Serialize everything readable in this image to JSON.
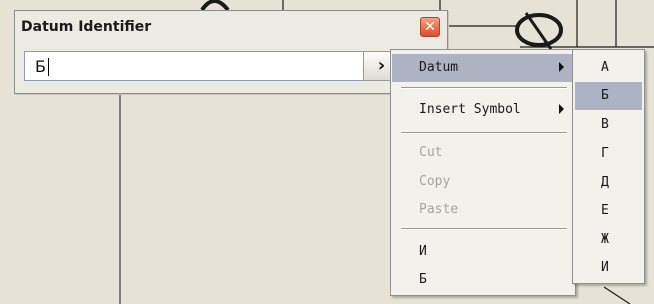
{
  "dialog": {
    "title": "Datum Identifier",
    "close_glyph": "✕",
    "field_value": "Б",
    "arrow_glyph": "›"
  },
  "menu": {
    "items": [
      {
        "label": "Datum",
        "state": "highlighted",
        "submenu": true
      },
      {
        "label": "Insert Symbol",
        "state": "enabled",
        "submenu": true
      },
      {
        "label": "Cut",
        "state": "disabled"
      },
      {
        "label": "Copy",
        "state": "disabled"
      },
      {
        "label": "Paste",
        "state": "disabled"
      },
      {
        "label": "И",
        "state": "enabled"
      },
      {
        "label": "Б",
        "state": "enabled"
      }
    ]
  },
  "submenu": {
    "items": [
      {
        "label": "А",
        "state": "enabled"
      },
      {
        "label": "Б",
        "state": "highlighted"
      },
      {
        "label": "В",
        "state": "enabled"
      },
      {
        "label": "Г",
        "state": "enabled"
      },
      {
        "label": "Д",
        "state": "enabled"
      },
      {
        "label": "Е",
        "state": "enabled"
      },
      {
        "label": "Ж",
        "state": "enabled"
      },
      {
        "label": "И",
        "state": "enabled"
      }
    ]
  },
  "colors": {
    "background": "#e6e3d6",
    "highlight": "#aeb2c2",
    "disabled_text": "#a6a6a0",
    "close_button": "#dd4d2b"
  }
}
